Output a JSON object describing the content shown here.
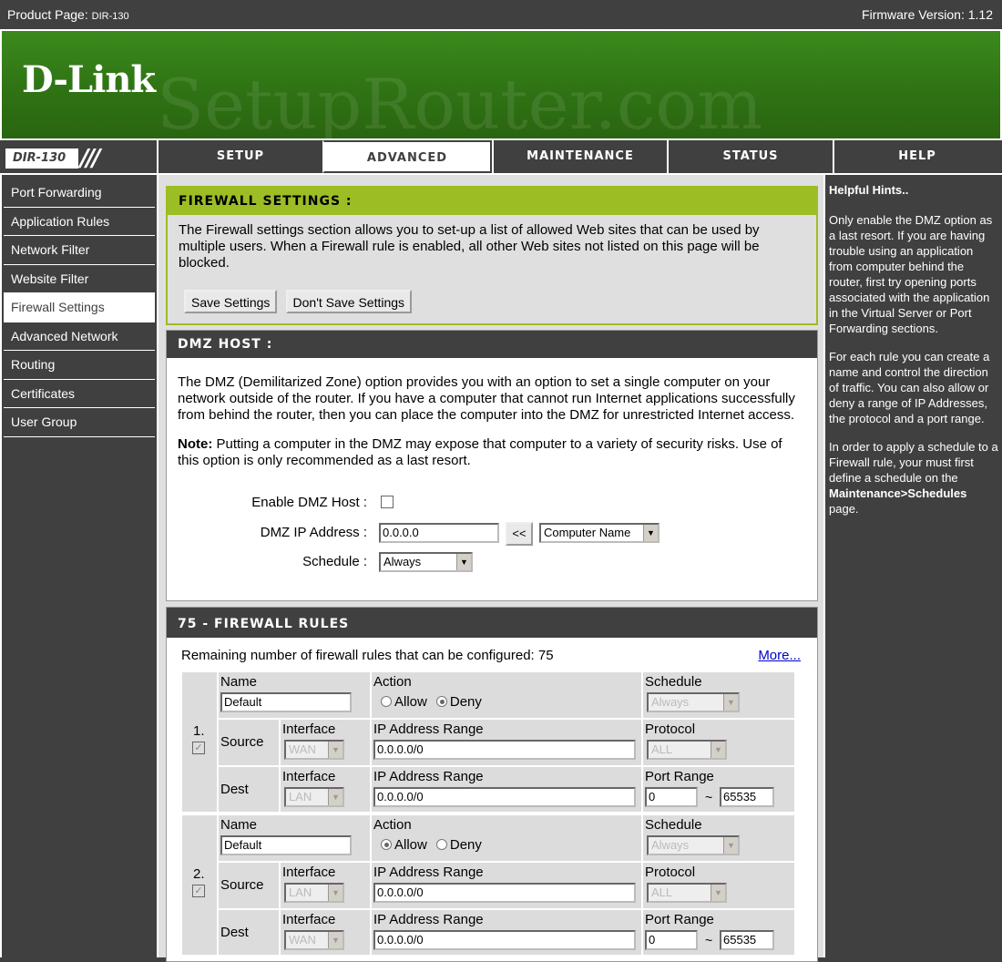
{
  "topbar": {
    "product_label": "Product Page:",
    "product_model": "DIR-130",
    "firmware": "Firmware Version: 1.12"
  },
  "banner": {
    "logo": "D-Link",
    "watermark": "SetupRouter.com"
  },
  "nav": {
    "model": "DIR-130",
    "tabs": [
      "SETUP",
      "ADVANCED",
      "MAINTENANCE",
      "STATUS",
      "HELP"
    ],
    "active_tab": "ADVANCED"
  },
  "sidebar": {
    "items": [
      "Port Forwarding",
      "Application Rules",
      "Network Filter",
      "Website Filter",
      "Firewall Settings",
      "Advanced Network",
      "Routing",
      "Certificates",
      "User Group"
    ],
    "active": "Firewall Settings"
  },
  "firewall_settings": {
    "title": "FIREWALL SETTINGS :",
    "description": "The Firewall settings section allows you to set-up a list of allowed Web sites that can be used by multiple users. When a Firewall rule is enabled, all other Web sites not listed on this page will be blocked.",
    "save_label": "Save Settings",
    "dont_save_label": "Don't Save Settings"
  },
  "dmz": {
    "title": "DMZ HOST :",
    "description": "The DMZ (Demilitarized Zone) option provides you with an option to set a single computer on your network outside of the router. If you have a computer that cannot run Internet applications successfully from behind the router, then you can place the computer into the DMZ for unrestricted Internet access.",
    "note_label": "Note:",
    "note_text": " Putting a computer in the DMZ may expose that computer to a variety of security risks. Use of this option is only recommended as a last resort.",
    "enable_label": "Enable DMZ Host :",
    "enabled": false,
    "ip_label": "DMZ IP Address :",
    "ip_value": "0.0.0.0",
    "copy_button": "<<",
    "computer_select": "Computer Name",
    "schedule_label": "Schedule :",
    "schedule_value": "Always"
  },
  "rules": {
    "title": "75 - FIREWALL RULES",
    "remaining_text": "Remaining number of firewall rules that can be configured: 75",
    "more_link": "More...",
    "labels": {
      "name": "Name",
      "action": "Action",
      "allow": "Allow",
      "deny": "Deny",
      "schedule": "Schedule",
      "source": "Source",
      "dest": "Dest",
      "interface": "Interface",
      "ip_range": "IP Address Range",
      "protocol": "Protocol",
      "port_range": "Port Range",
      "tilde": "~"
    },
    "items": [
      {
        "num": "1.",
        "name": "Default",
        "action": "Deny",
        "schedule": "Always",
        "src_interface": "WAN",
        "src_ip": "0.0.0.0/0",
        "protocol": "ALL",
        "dst_interface": "LAN",
        "dst_ip": "0.0.0.0/0",
        "port_start": "0",
        "port_end": "65535"
      },
      {
        "num": "2.",
        "name": "Default",
        "action": "Allow",
        "schedule": "Always",
        "src_interface": "LAN",
        "src_ip": "0.0.0.0/0",
        "protocol": "ALL",
        "dst_interface": "WAN",
        "dst_ip": "0.0.0.0/0",
        "port_start": "0",
        "port_end": "65535"
      }
    ]
  },
  "hints": {
    "title": "Helpful Hints..",
    "p1": "Only enable the DMZ option as a last resort. If you are having trouble using an application from computer behind the router, first try opening ports associated with the application in the Virtual Server or Port Forwarding sections.",
    "p2": "For each rule you can create a name and control the direction of traffic. You can also allow or deny a range of IP Addresses, the protocol and a port range.",
    "p3_pre": "In order to apply a schedule to a Firewall rule, your must first define a schedule on the ",
    "p3_bold": "Maintenance>Schedules",
    "p3_post": " page."
  }
}
